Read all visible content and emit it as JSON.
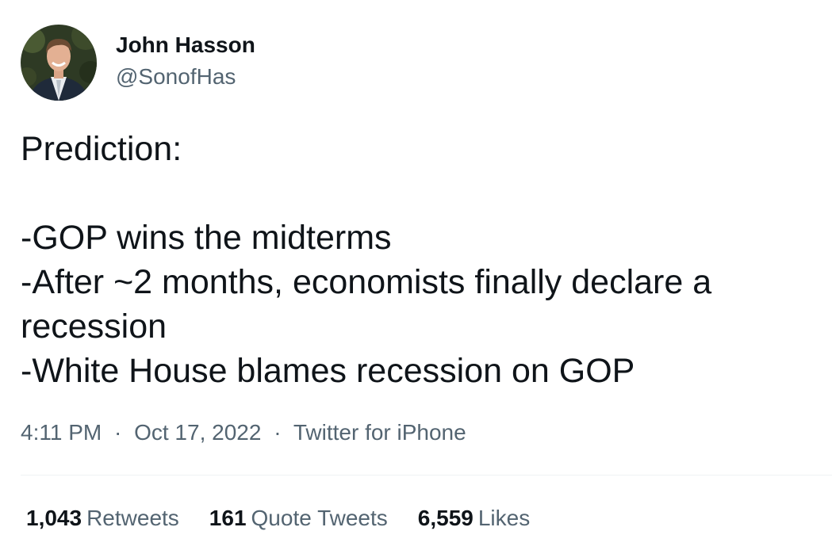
{
  "user": {
    "display_name": "John Hasson",
    "handle": "@SonofHas"
  },
  "tweet": {
    "lines": [
      "Prediction:",
      "",
      "-GOP wins the midterms",
      "-After ~2 months, economists finally declare a",
      "recession",
      "-White House blames recession on GOP"
    ],
    "time": "4:11 PM",
    "date": "Oct 17, 2022",
    "source": "Twitter for iPhone",
    "separator": "·"
  },
  "stats": {
    "retweets_count": "1,043",
    "retweets_label": "Retweets",
    "quotes_count": "161",
    "quotes_label": "Quote Tweets",
    "likes_count": "6,559",
    "likes_label": "Likes"
  },
  "colors": {
    "text_primary": "#0f1419",
    "text_secondary": "#536471",
    "divider": "#eff3f4"
  }
}
